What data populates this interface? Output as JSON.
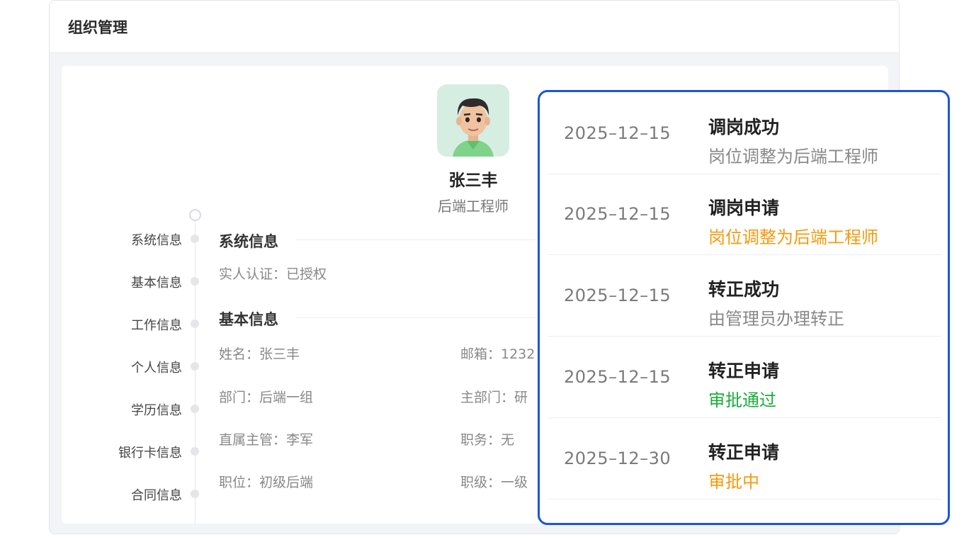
{
  "header": {
    "title": "组织管理"
  },
  "profile": {
    "name": "张三丰",
    "role": "后端工程师"
  },
  "sidebar": {
    "items": [
      {
        "label": "系统信息"
      },
      {
        "label": "基本信息"
      },
      {
        "label": "工作信息"
      },
      {
        "label": "个人信息"
      },
      {
        "label": "学历信息"
      },
      {
        "label": "银行卡信息"
      },
      {
        "label": "合同信息"
      }
    ]
  },
  "sections": {
    "system": {
      "title": "系统信息",
      "auth": "实人认证：已授权"
    },
    "basic": {
      "title": "基本信息",
      "name": "姓名：张三丰",
      "email": "邮箱：1232",
      "dept": "部门：后端一组",
      "main_dept": "主部门：研",
      "manager": "直属主管：李军",
      "duty": "职务：无",
      "position": "职位：初级后端",
      "level": "职级：一级"
    }
  },
  "records": [
    {
      "date": "2025–12–15",
      "title": "调岗成功",
      "desc": "岗位调整为后端工程师",
      "color": "#888888"
    },
    {
      "date": "2025–12–15",
      "title": "调岗申请",
      "desc": "岗位调整为后端工程师",
      "color": "#f59a0c"
    },
    {
      "date": "2025–12–15",
      "title": "转正成功",
      "desc": "由管理员办理转正",
      "color": "#888888"
    },
    {
      "date": "2025–12–15",
      "title": "转正申请",
      "desc": "审批通过",
      "color": "#1aad3a"
    },
    {
      "date": "2025–12–30",
      "title": "转正申请",
      "desc": "审批中",
      "color": "#f59a0c"
    }
  ],
  "colors": {
    "accent": "#1a56db",
    "pending": "#f59a0c",
    "approved": "#1aad3a"
  }
}
